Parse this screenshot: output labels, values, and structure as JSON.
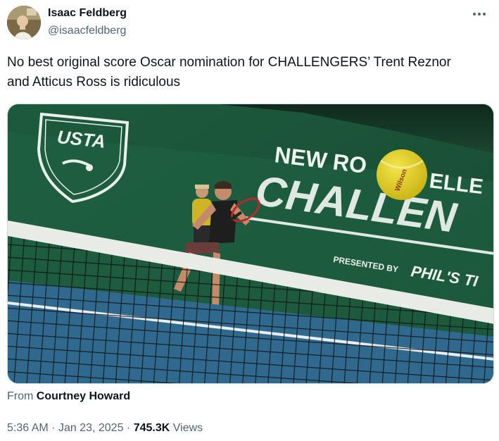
{
  "author": {
    "display_name": "Isaac Feldberg",
    "handle": "@isaacfeldberg",
    "avatar_icon": "profile-photo"
  },
  "more_icon": "more-horizontal-icon",
  "tweet": {
    "text": "No best original score Oscar nomination for CHALLENGERS’ Trent Reznor and Atticus Ross is ridiculous"
  },
  "media": {
    "sign_top": "NEW RO",
    "sign_top_right": "ELLE",
    "sign_main": "CHALLEN",
    "sign_presented": "PRESENTED BY",
    "sign_sponsor": "PHIL'S TI",
    "usta_logo": "USTA",
    "ball_text": "Wilson"
  },
  "attribution": {
    "prefix": "From",
    "source": "Courtney Howard"
  },
  "meta": {
    "time": "5:36 AM",
    "separator": "·",
    "date": "Jan 23, 2025",
    "views_count": "745.3K",
    "views_label": "Views"
  },
  "colors": {
    "wall_green": "#1f5a3e",
    "court_blue": "#2f6a8e",
    "ball_yellow": "#e7d21c",
    "text_primary": "#0f1419",
    "text_secondary": "#536471"
  }
}
